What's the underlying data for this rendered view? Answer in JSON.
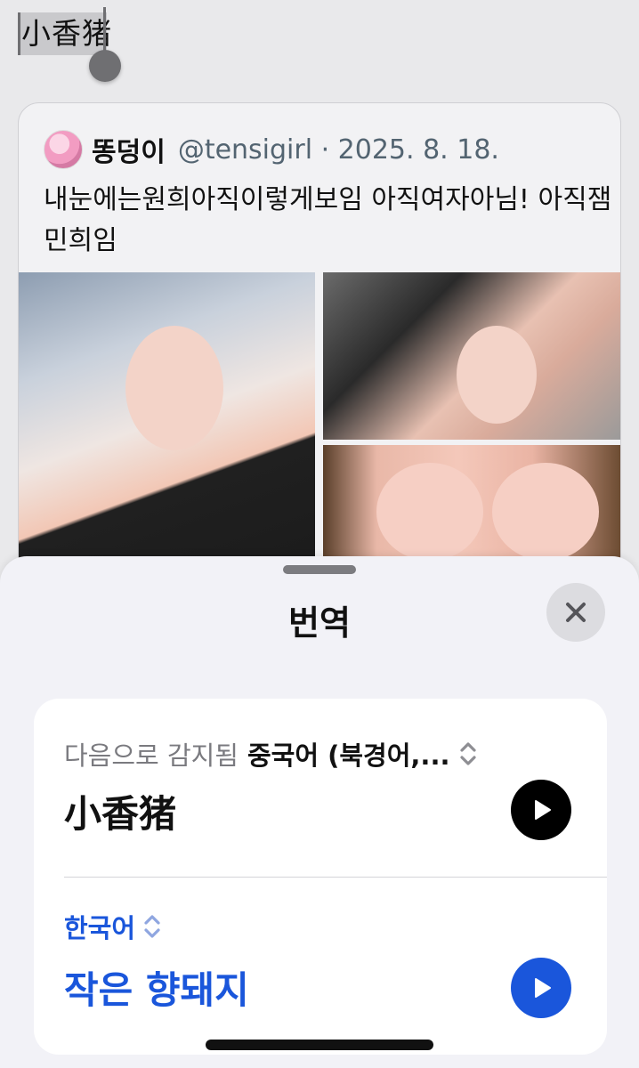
{
  "selection": {
    "text": "小香猪"
  },
  "tweet": {
    "name": "똥덩이",
    "handle_and_date": "@tensigirl · 2025. 8. 18.",
    "text": "내눈에는원희아직이렇게보임 아직여자아님! 아직잼민희임"
  },
  "sheet": {
    "title": "번역",
    "detected_prefix": "다음으로 감지됨",
    "detected_language": "중국어 (북경어,...",
    "source_text": "小香猪",
    "target_language": "한국어",
    "target_text": "작은 향돼지"
  },
  "icons": {
    "close": "close-icon",
    "play": "play-icon",
    "chevron_updown": "chevron-updown-icon"
  },
  "colors": {
    "accent": "#1a56db",
    "sheet_bg": "#f2f2f7"
  }
}
